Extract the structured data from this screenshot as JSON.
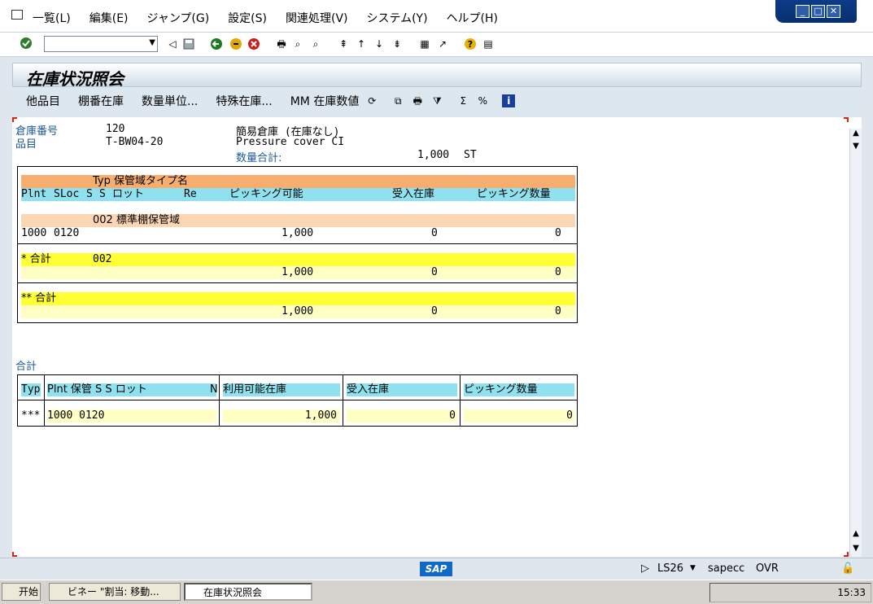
{
  "menu": {
    "items": [
      "一覧(L)",
      "編集(E)",
      "ジャンプ(G)",
      "設定(S)",
      "関連処理(V)",
      "システム(Y)",
      "ヘルプ(H)"
    ]
  },
  "window_controls": [
    "_",
    "□",
    "✕"
  ],
  "toolbar": {
    "command_field_value": "",
    "icons": [
      "enter-icon",
      "back-icon",
      "save-icon",
      "green-back-icon",
      "exit-icon",
      "cancel-icon",
      "print-icon",
      "find-icon",
      "find-next-icon",
      "first-page-icon",
      "prev-page-icon",
      "next-page-icon",
      "last-page-icon",
      "create-session-icon",
      "shortcut-icon",
      "help-icon",
      "layout-icon"
    ]
  },
  "title": "在庫状況照会",
  "app_toolbar": {
    "buttons": [
      "他品目",
      "棚番在庫",
      "数量単位...",
      "特殊在庫...",
      "MM 在庫数値"
    ],
    "icons": [
      "refresh-icon",
      "detail-icon",
      "print-icon",
      "filter-icon",
      "sum-icon",
      "subtotal-icon",
      "info-icon"
    ]
  },
  "header": {
    "warehouse_label": "倉庫番号",
    "warehouse_value": "120",
    "warehouse_desc": "簡易倉庫 (在庫なし)",
    "material_label": "品目",
    "material_value": "T-BW04-20",
    "material_desc": "Pressure cover CI",
    "total_label": "数量合計:",
    "total_qty": "1,000",
    "total_unit": "ST"
  },
  "list1": {
    "header1": "Typ 保管域タイプ名",
    "header2": {
      "plnt": "Plnt",
      "sloc": "SLoc",
      "s1": "S",
      "s2": "S",
      "lot": "ロット",
      "re": "Re",
      "pickable": "ピッキング可能",
      "gr_stock": "受入在庫",
      "pick_qty": "ピッキング数量"
    },
    "group_header": "002 標準棚保管域",
    "row": {
      "plnt": "1000",
      "sloc": "0120",
      "pickable": "1,000",
      "gr_stock": "0",
      "pick_qty": "0"
    },
    "subtotal_label": "* 合計",
    "subtotal_type": "002",
    "subtotal": {
      "pickable": "1,000",
      "gr_stock": "0",
      "pick_qty": "0"
    },
    "total_label": "** 合計",
    "total": {
      "pickable": "1,000",
      "gr_stock": "0",
      "pick_qty": "0"
    }
  },
  "list2": {
    "section_title": "合計",
    "headers": {
      "typ": "Typ",
      "plnt_group": "Plnt 保管 S S ロット",
      "n": "N",
      "available": "利用可能在庫",
      "gr_stock": "受入在庫",
      "pick_qty": "ピッキング数量"
    },
    "row": {
      "typ": "***",
      "plnt_group": "1000 0120",
      "available": "1,000",
      "gr_stock": "0",
      "pick_qty": "0"
    }
  },
  "status_bar": {
    "logo": "SAP",
    "system": "LS26",
    "server": "sapecc",
    "mode": "OVR"
  },
  "taskbar": {
    "start": "开始",
    "tasks": [
      "ビネー \"割当: 移動...",
      "在庫状況照会"
    ],
    "tray_time": "15:33"
  },
  "colors": {
    "header_orange": "#f6ad6e",
    "group_light_orange": "#fbd5b4",
    "column_cyan": "#8fe1ef",
    "total_yellow": "#ffff33",
    "total_light_yellow": "#ffffc4",
    "label_blue": "#1c5a98"
  }
}
